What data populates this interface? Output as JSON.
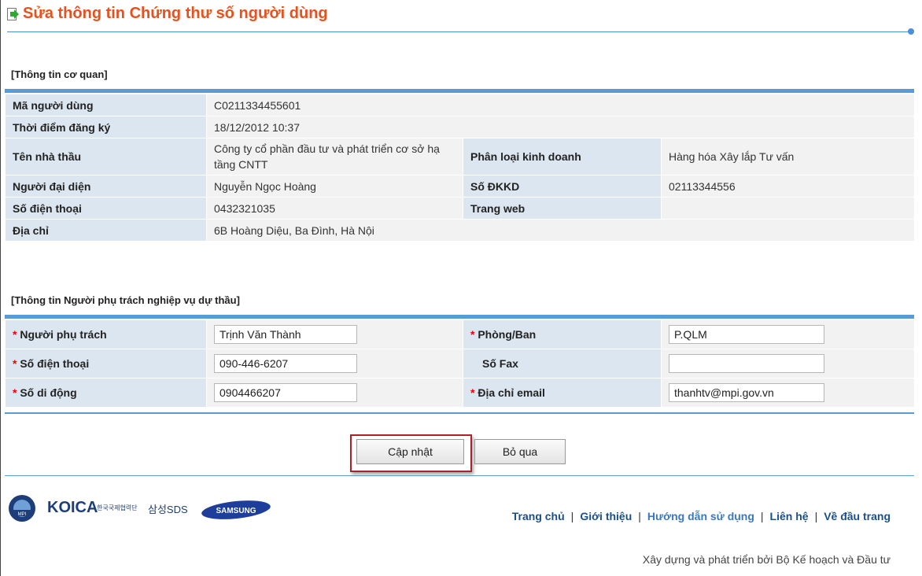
{
  "page": {
    "title": "Sửa thông tin Chứng thư số người dùng"
  },
  "org_section": {
    "heading": "[Thông tin cơ quan]",
    "user_code": {
      "label": "Mã người dùng",
      "value": "C0211334455601"
    },
    "reg_time": {
      "label": "Thời điểm đăng ký",
      "value": "18/12/2012 10:37"
    },
    "contractor": {
      "label": "Tên nhà thầu",
      "value": "Công ty cổ phần đầu tư và phát triển cơ sở hạ tầng CNTT"
    },
    "biz_type": {
      "label": "Phân loại kinh doanh",
      "value": "Hàng hóa Xây lắp Tư vấn"
    },
    "rep": {
      "label": "Người đại diện",
      "value": "Nguyễn Ngọc Hoàng"
    },
    "dkkd": {
      "label": "Số ĐKKD",
      "value": "02113344556"
    },
    "phone": {
      "label": "Số điện thoại",
      "value": "0432321035"
    },
    "website": {
      "label": "Trang web",
      "value": ""
    },
    "address": {
      "label": "Địa chỉ",
      "value": "6B Hoàng Diệu, Ba Đình, Hà Nội"
    }
  },
  "person_section": {
    "heading": "[Thông tin Người phụ trách nghiệp vụ dự thầu]",
    "req_mark": "*",
    "in_charge": {
      "label": "Người phụ trách",
      "value": "Trịnh Văn Thành"
    },
    "dept": {
      "label": "Phòng/Ban",
      "value": "P.QLM"
    },
    "phone": {
      "label": "Số điện thoại",
      "value": "090-446-6207"
    },
    "fax": {
      "label": "Số Fax",
      "value": ""
    },
    "mobile": {
      "label": "Số di động",
      "value": "0904466207"
    },
    "email": {
      "label": "Địa chỉ email",
      "value": "thanhtv@mpi.gov.vn"
    }
  },
  "actions": {
    "update": "Cập nhật",
    "cancel": "Bỏ qua"
  },
  "footer": {
    "links": [
      "Trang chủ",
      "Giới thiệu",
      "Hướng dẫn sử dụng",
      "Liên hệ",
      "Về đầu trang"
    ],
    "separator": "|",
    "credit": "Xây dựng và phát triển bởi Bộ Kế hoạch và Đầu tư",
    "logos": {
      "koica": "KOICA",
      "koica_sub": "한국국제협력단",
      "sds": "삼성SDS",
      "samsung": "SAMSUNG",
      "mpi": "MPI"
    }
  },
  "colors": {
    "title": "#e8501e",
    "accent": "#5b9bd5",
    "label_bg": "#dce6f0",
    "value_bg": "#f2f2f2",
    "highlight": "#b0202a"
  }
}
